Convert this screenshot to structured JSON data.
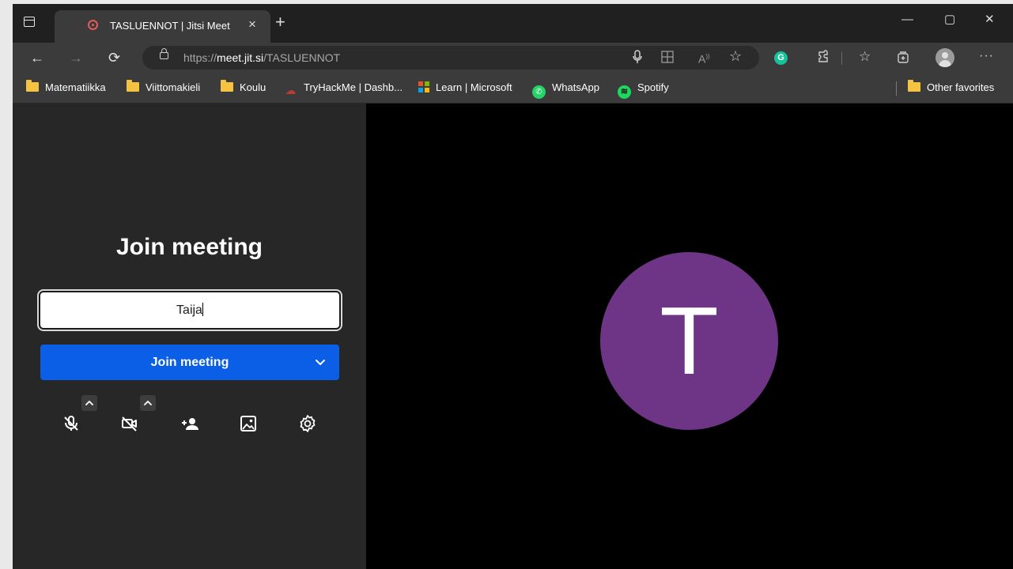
{
  "browser": {
    "tab": {
      "title": "TASLUENNOT | Jitsi Meet",
      "close": "×"
    },
    "new_tab": "+",
    "window_controls": {
      "minimize": "—",
      "maximize": "▢",
      "close": "✕"
    },
    "address": {
      "prefix": "https://",
      "domain": "meet.jit.si",
      "path": "/TASLUENNOT"
    },
    "favorites": [
      {
        "label": "Matematiikka",
        "icon": "folder-icon"
      },
      {
        "label": "Viittomakieli",
        "icon": "folder-icon"
      },
      {
        "label": "Koulu",
        "icon": "folder-icon"
      },
      {
        "label": "TryHackMe | Dashb...",
        "icon": "tryhackme-icon"
      },
      {
        "label": "Learn | Microsoft",
        "icon": "microsoft-icon"
      },
      {
        "label": "WhatsApp",
        "icon": "whatsapp-icon"
      },
      {
        "label": "Spotify",
        "icon": "spotify-icon"
      }
    ],
    "other_favorites": "Other favorites"
  },
  "prejoin": {
    "title": "Join meeting",
    "name_value": "Taija",
    "join_label": "Join meeting",
    "toolbar": [
      "microphone-muted-icon",
      "camera-off-icon",
      "invite-people-icon",
      "virtual-background-icon",
      "settings-icon"
    ]
  },
  "preview": {
    "avatar_initial": "T",
    "avatar_color": "#6e3486"
  },
  "colors": {
    "accent": "#0b5ee6",
    "panel": "#272727"
  }
}
